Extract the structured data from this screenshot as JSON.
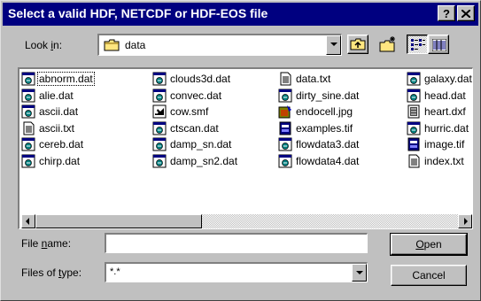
{
  "window": {
    "title": "Select a valid HDF, NETCDF or HDF-EOS file"
  },
  "titlebar": {
    "help_label": "?",
    "close_label": "×"
  },
  "lookin": {
    "label_pre": "Look ",
    "label_ul": "i",
    "label_post": "n:",
    "value": "data"
  },
  "files": [
    {
      "name": "abnorm.dat",
      "icon": "dat-icon",
      "selected": true
    },
    {
      "name": "alie.dat",
      "icon": "dat-icon"
    },
    {
      "name": "ascii.dat",
      "icon": "dat-icon"
    },
    {
      "name": "ascii.txt",
      "icon": "text-file-icon"
    },
    {
      "name": "cereb.dat",
      "icon": "dat-icon"
    },
    {
      "name": "chirp.dat",
      "icon": "dat-icon"
    },
    {
      "name": "clouds3d.dat",
      "icon": "dat-icon"
    },
    {
      "name": "convec.dat",
      "icon": "dat-icon"
    },
    {
      "name": "cow.smf",
      "icon": "smf-icon"
    },
    {
      "name": "ctscan.dat",
      "icon": "dat-icon"
    },
    {
      "name": "damp_sn.dat",
      "icon": "dat-icon"
    },
    {
      "name": "damp_sn2.dat",
      "icon": "dat-icon"
    },
    {
      "name": "data.txt",
      "icon": "text-file-icon"
    },
    {
      "name": "dirty_sine.dat",
      "icon": "dat-icon"
    },
    {
      "name": "endocell.jpg",
      "icon": "image-file-icon"
    },
    {
      "name": "examples.tif",
      "icon": "tif-icon"
    },
    {
      "name": "flowdata3.dat",
      "icon": "dat-icon"
    },
    {
      "name": "flowdata4.dat",
      "icon": "dat-icon"
    },
    {
      "name": "galaxy.dat",
      "icon": "dat-icon"
    },
    {
      "name": "head.dat",
      "icon": "dat-icon"
    },
    {
      "name": "heart.dxf",
      "icon": "dxf-icon"
    },
    {
      "name": "hurric.dat",
      "icon": "dat-icon"
    },
    {
      "name": "image.tif",
      "icon": "tif-icon"
    },
    {
      "name": "index.txt",
      "icon": "text-file-icon"
    }
  ],
  "filename": {
    "label_ul": "n",
    "label_pre": "File ",
    "label_post": "ame:",
    "value": ""
  },
  "filetype": {
    "label_pre": "Files of ",
    "label_ul": "t",
    "label_post": "ype:",
    "value": "*.*"
  },
  "buttons": {
    "open_ul": "O",
    "open_rest": "pen",
    "cancel": "Cancel"
  }
}
